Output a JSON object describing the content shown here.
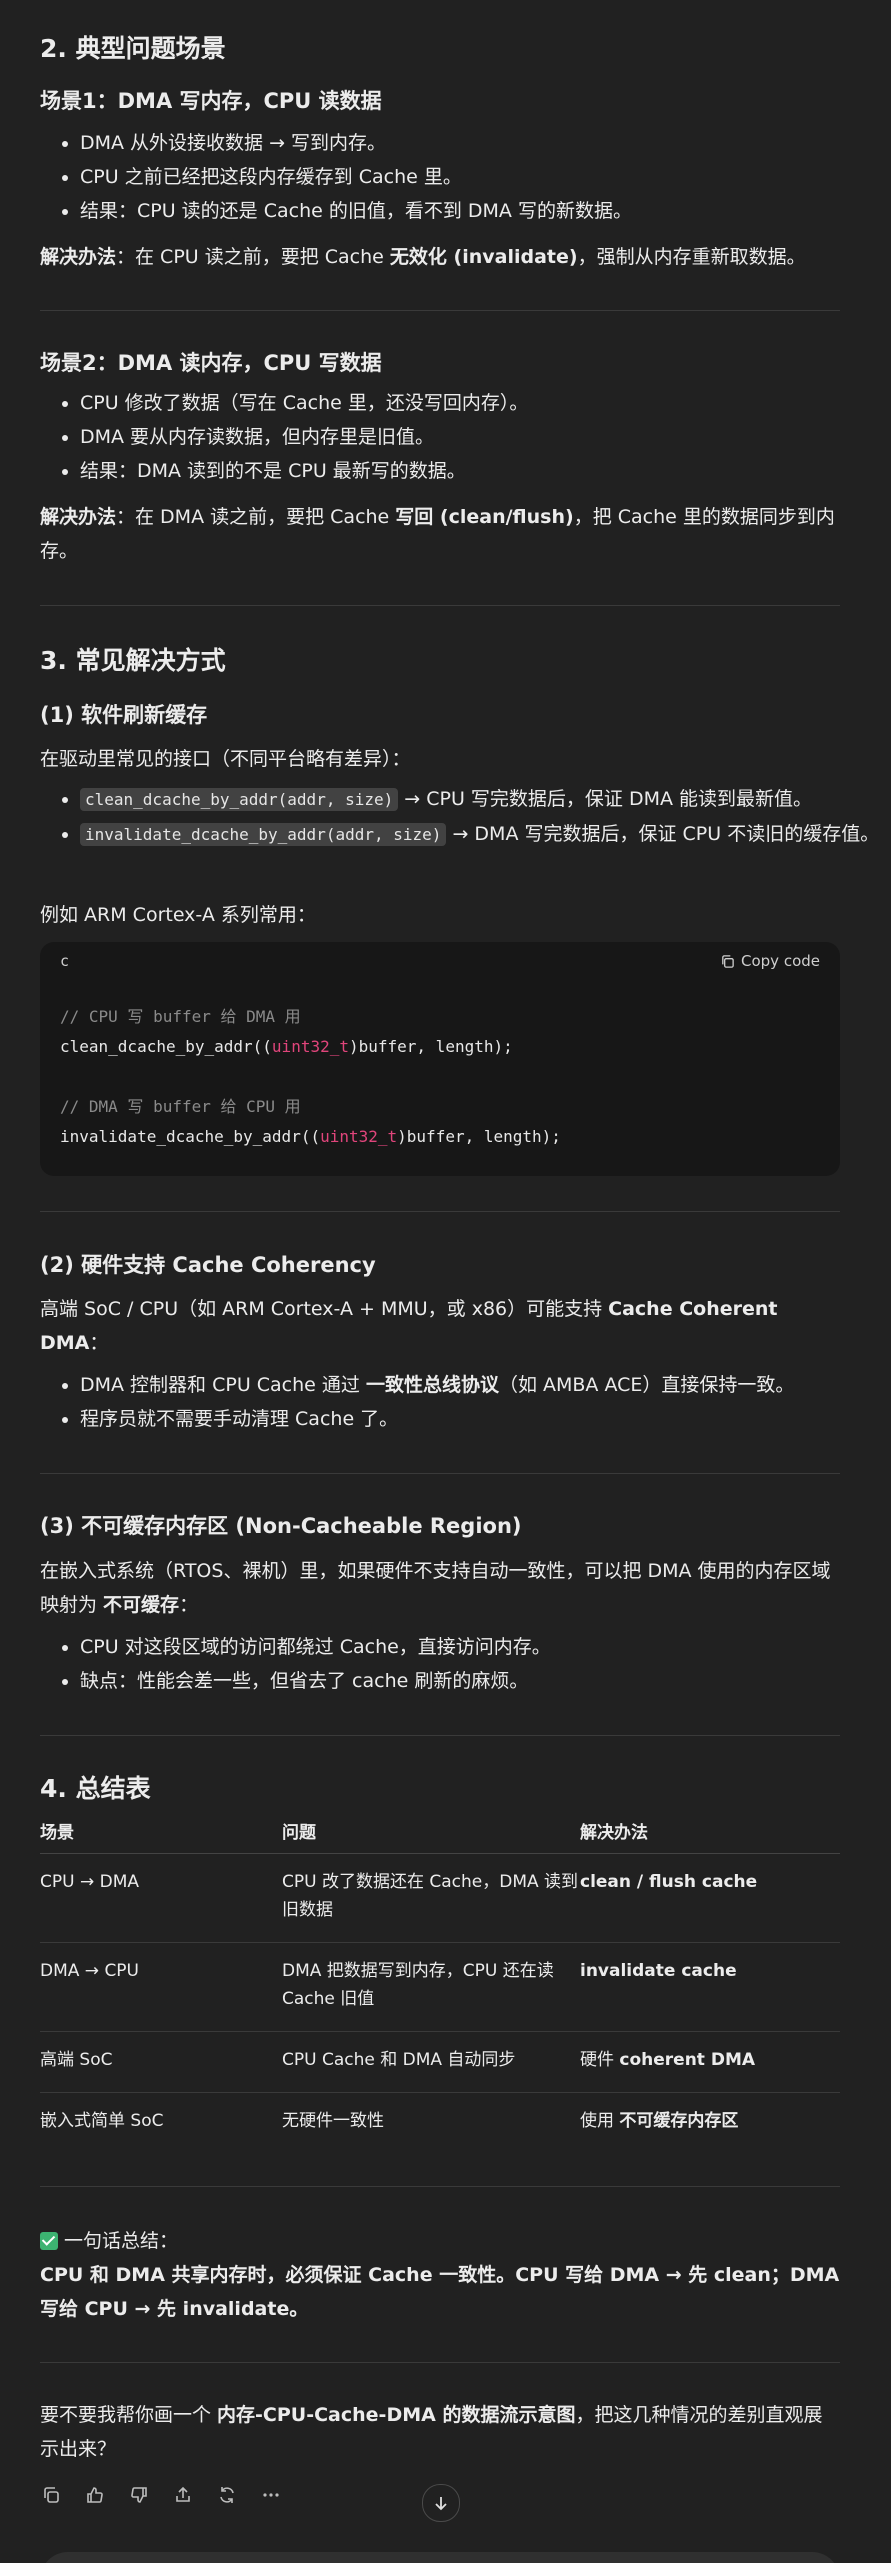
{
  "sec2": {
    "title": "2. 典型问题场景",
    "s1": {
      "title": "场景1：DMA 写内存，CPU 读数据",
      "items": [
        "DMA 从外设接收数据 → 写到内存。",
        "CPU 之前已经把这段内存缓存到 Cache 里。",
        "结果：CPU 读的还是 Cache 的旧值，看不到 DMA 写的新数据。"
      ],
      "sol_label": "解决办法",
      "sol_a": "：在 CPU 读之前，要把 Cache ",
      "sol_b": "无效化 (invalidate)",
      "sol_c": "，强制从内存重新取数据。"
    },
    "s2": {
      "title": "场景2：DMA 读内存，CPU 写数据",
      "items": [
        "CPU 修改了数据（写在 Cache 里，还没写回内存）。",
        "DMA 要从内存读数据，但内存里是旧值。",
        "结果：DMA 读到的不是 CPU 最新写的数据。"
      ],
      "sol_label": "解决办法",
      "sol_a": "：在 DMA 读之前，要把 Cache ",
      "sol_b": "写回 (clean/flush)",
      "sol_c": "，把 Cache 里的数据同步到内存。"
    }
  },
  "sec3": {
    "title": "3. 常见解决方式",
    "p1": {
      "title": "(1) 软件刷新缓存",
      "intro": "在驱动里常见的接口（不同平台略有差异）：",
      "items": [
        {
          "code": "clean_dcache_by_addr(addr, size)",
          "text": " → CPU 写完数据后，保证 DMA 能读到最新值。"
        },
        {
          "code": "invalidate_dcache_by_addr(addr, size)",
          "text": " → DMA 写完数据后，保证 CPU 不读旧的缓存值。"
        }
      ],
      "example": "例如 ARM Cortex-A 系列常用：",
      "code": {
        "lang": "c",
        "copy_label": "Copy code",
        "comment1": "// CPU 写 buffer 给 DMA 用",
        "line1_a": "clean_dcache_by_addr((",
        "line1_type": "uint32_t",
        "line1_b": ")buffer, length);",
        "comment2": "// DMA 写 buffer 给 CPU 用",
        "line2_a": "invalidate_dcache_by_addr((",
        "line2_type": "uint32_t",
        "line2_b": ")buffer, length);"
      }
    },
    "p2": {
      "title": "(2) 硬件支持 Cache Coherency",
      "intro_a": "高端 SoC / CPU（如 ARM Cortex-A + MMU，或 x86）可能支持 ",
      "intro_b": "Cache Coherent DMA",
      "intro_c": "：",
      "item1_a": "DMA 控制器和 CPU Cache 通过 ",
      "item1_b": "一致性总线协议",
      "item1_c": "（如 AMBA ACE）直接保持一致。",
      "item2": "程序员就不需要手动清理 Cache 了。"
    },
    "p3": {
      "title": "(3) 不可缓存内存区 (Non-Cacheable Region)",
      "intro_a": "在嵌入式系统（RTOS、裸机）里，如果硬件不支持自动一致性，可以把 DMA 使用的内存区域映射为 ",
      "intro_b": "不可缓存",
      "intro_c": "：",
      "items": [
        "CPU 对这段区域的访问都绕过 Cache，直接访问内存。",
        "缺点：性能会差一些，但省去了 cache 刷新的麻烦。"
      ]
    }
  },
  "sec4": {
    "title": "4. 总结表",
    "headers": [
      "场景",
      "问题",
      "解决办法"
    ],
    "rows": [
      {
        "c1": "CPU → DMA",
        "c2": "CPU 改了数据还在 Cache，DMA 读到旧数据",
        "c3_pre": "",
        "c3_b": "clean / flush cache"
      },
      {
        "c1": "DMA → CPU",
        "c2": "DMA 把数据写到内存，CPU 还在读 Cache 旧值",
        "c3_pre": "",
        "c3_b": "invalidate cache"
      },
      {
        "c1": "高端 SoC",
        "c2": "CPU Cache 和 DMA 自动同步",
        "c3_pre": "硬件 ",
        "c3_b": "coherent DMA"
      },
      {
        "c1": "嵌入式简单 SoC",
        "c2": "无硬件一致性",
        "c3_pre": "使用 ",
        "c3_b": "不可缓存内存区"
      }
    ]
  },
  "summary": {
    "label": "一句话总结：",
    "text": "CPU 和 DMA 共享内存时，必须保证 Cache 一致性。CPU 写给 DMA → 先 clean；DMA 写给 CPU → 先 invalidate。"
  },
  "followup": {
    "a": "要不要我帮你画一个 ",
    "b": "内存-CPU-Cache-DMA 的数据流示意图",
    "c": "，把这几种情况的差别直观展示出来？"
  },
  "actions": [
    "copy-icon",
    "thumbs-up-icon",
    "thumbs-down-icon",
    "share-icon",
    "regenerate-icon",
    "more-icon"
  ]
}
